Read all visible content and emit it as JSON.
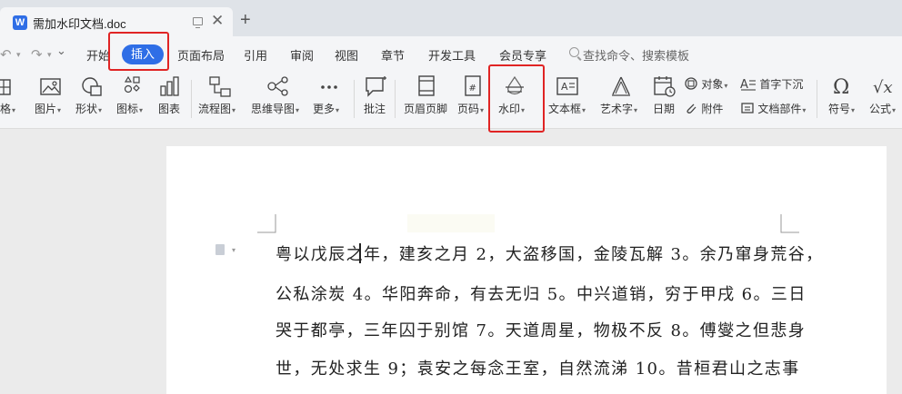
{
  "window": {
    "tab_title": "需加水印文档.doc",
    "app_icon": "W",
    "close_glyph": "✕",
    "new_tab_glyph": "+"
  },
  "menu": {
    "undo_glyph": "↶",
    "redo_glyph": "↷",
    "dropdown_glyph": "⌄",
    "items": [
      "开始",
      "插入",
      "页面布局",
      "引用",
      "审阅",
      "视图",
      "章节",
      "开发工具",
      "会员专享"
    ],
    "active": "插入",
    "search_placeholder": "查找命令、搜索模板"
  },
  "ribbon": {
    "tools": [
      {
        "id": "table",
        "label": "格"
      },
      {
        "id": "picture",
        "label": "图片"
      },
      {
        "id": "shape",
        "label": "形状"
      },
      {
        "id": "icon",
        "label": "图标"
      },
      {
        "id": "chart",
        "label": "图表"
      },
      {
        "id": "flowchart",
        "label": "流程图"
      },
      {
        "id": "mindmap",
        "label": "思维导图"
      },
      {
        "id": "more",
        "label": "更多"
      },
      {
        "id": "comment",
        "label": "批注"
      },
      {
        "id": "header-footer",
        "label": "页眉页脚"
      },
      {
        "id": "page-number",
        "label": "页码"
      },
      {
        "id": "watermark",
        "label": "水印"
      },
      {
        "id": "textbox",
        "label": "文本框"
      },
      {
        "id": "wordart",
        "label": "艺术字"
      },
      {
        "id": "date",
        "label": "日期"
      },
      {
        "id": "symbol",
        "label": "符号"
      },
      {
        "id": "formula",
        "label": "公式"
      }
    ],
    "small_tools": {
      "object": "对象",
      "attachment": "附件",
      "dropcap": "首字下沉",
      "doc_parts": "文档部件"
    },
    "dropdown_caret": "▾"
  },
  "document": {
    "lines": [
      "粤以戊辰之年，建亥之月 2，大盗移国，金陵瓦解 3。余乃窜身荒谷，",
      "公私涂炭 4。华阳奔命，有去无归 5。中兴道销，穷于甲戌 6。三日",
      "哭于都亭，三年囚于别馆 7。天道周星，物极不反 8。傅燮之但悲身",
      "世，无处求生 9；袁安之每念王室，自然流涕 10。昔桓君山之志事"
    ]
  },
  "colors": {
    "accent": "#2f6ee6",
    "highlight": "#e02424"
  }
}
